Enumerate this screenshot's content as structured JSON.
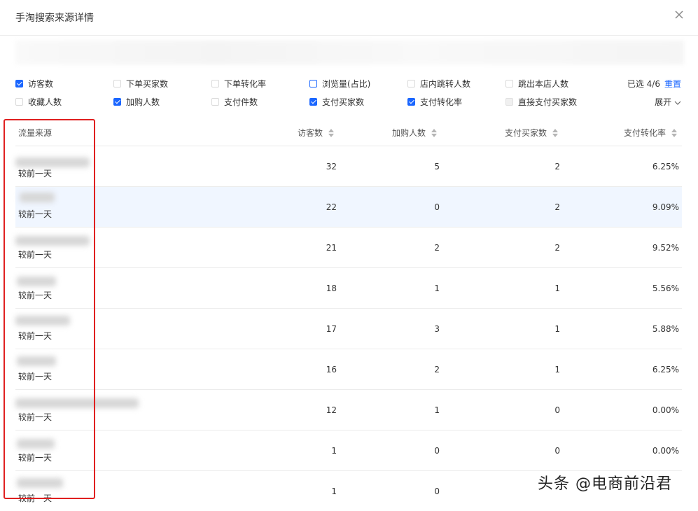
{
  "dialog": {
    "title": "手淘搜索来源详情"
  },
  "filters": {
    "row1": [
      {
        "label": "访客数",
        "state": "checked"
      },
      {
        "label": "下单买家数",
        "state": "unchecked"
      },
      {
        "label": "下单转化率",
        "state": "unchecked"
      },
      {
        "label": "浏览量(占比)",
        "state": "outline"
      },
      {
        "label": "店内跳转人数",
        "state": "unchecked"
      },
      {
        "label": "跳出本店人数",
        "state": "unchecked"
      }
    ],
    "row2": [
      {
        "label": "收藏人数",
        "state": "unchecked"
      },
      {
        "label": "加购人数",
        "state": "checked"
      },
      {
        "label": "支付件数",
        "state": "unchecked"
      },
      {
        "label": "支付买家数",
        "state": "checked"
      },
      {
        "label": "支付转化率",
        "state": "checked"
      },
      {
        "label": "直接支付买家数",
        "state": "disabled"
      }
    ],
    "selected_text": "已选 4/6",
    "reset_label": "重置",
    "expand_label": "展开"
  },
  "table": {
    "headers": {
      "source": "流量来源",
      "visitors": "访客数",
      "add_cart": "加购人数",
      "buyers": "支付买家数",
      "conversion": "支付转化率"
    },
    "rows": [
      {
        "compare": "较前一天",
        "visitors": "32",
        "add_cart": "5",
        "buyers": "2",
        "conversion": "6.25%"
      },
      {
        "compare": "较前一天",
        "visitors": "22",
        "add_cart": "0",
        "buyers": "2",
        "conversion": "9.09%"
      },
      {
        "compare": "较前一天",
        "visitors": "21",
        "add_cart": "2",
        "buyers": "2",
        "conversion": "9.52%"
      },
      {
        "compare": "较前一天",
        "visitors": "18",
        "add_cart": "1",
        "buyers": "1",
        "conversion": "5.56%"
      },
      {
        "compare": "较前一天",
        "visitors": "17",
        "add_cart": "3",
        "buyers": "1",
        "conversion": "5.88%"
      },
      {
        "compare": "较前一天",
        "visitors": "16",
        "add_cart": "2",
        "buyers": "1",
        "conversion": "6.25%"
      },
      {
        "compare": "较前一天",
        "visitors": "12",
        "add_cart": "1",
        "buyers": "0",
        "conversion": "0.00%"
      },
      {
        "compare": "较前一天",
        "visitors": "1",
        "add_cart": "0",
        "buyers": "0",
        "conversion": "0.00%"
      },
      {
        "compare": "较前一天",
        "visitors": "1",
        "add_cart": "0",
        "buyers": "",
        "conversion": ""
      }
    ]
  },
  "watermark": "头条 @电商前沿君",
  "colors": {
    "accent": "#1a66ff",
    "highlight_row": "#f0f6ff",
    "annotation_box": "#e02020"
  }
}
